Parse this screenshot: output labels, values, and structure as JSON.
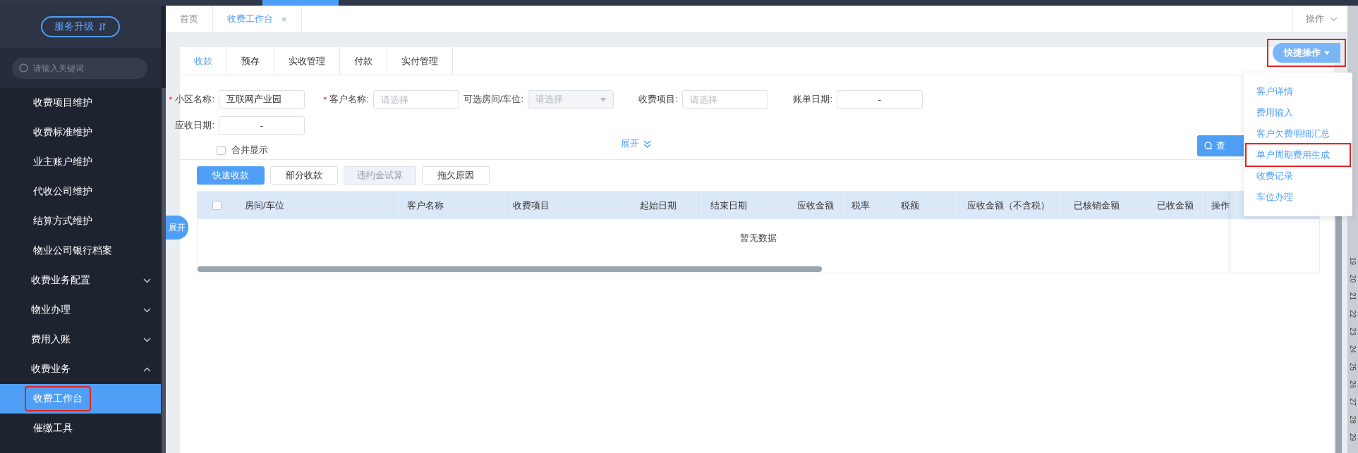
{
  "sidebar": {
    "upgrade_button": "服务升级",
    "search": {
      "placeholder": "请输入关键词"
    },
    "items": [
      {
        "label": "收费项目维护",
        "kind": "sub",
        "selected": false,
        "highlighted": false
      },
      {
        "label": "收费标准维护",
        "kind": "sub",
        "selected": false,
        "highlighted": false
      },
      {
        "label": "业主账户维护",
        "kind": "sub",
        "selected": false,
        "highlighted": false
      },
      {
        "label": "代收公司维护",
        "kind": "sub",
        "selected": false,
        "highlighted": false
      },
      {
        "label": "结算方式维护",
        "kind": "sub",
        "selected": false,
        "highlighted": false
      },
      {
        "label": "物业公司银行档案",
        "kind": "sub",
        "selected": false,
        "highlighted": false
      },
      {
        "label": "收费业务配置",
        "kind": "group",
        "expanded": false,
        "selected": false,
        "highlighted": false
      },
      {
        "label": "物业办理",
        "kind": "group",
        "expanded": false,
        "selected": false,
        "highlighted": false
      },
      {
        "label": "费用入账",
        "kind": "group",
        "expanded": false,
        "selected": false,
        "highlighted": false
      },
      {
        "label": "收费业务",
        "kind": "group",
        "expanded": true,
        "selected": false,
        "highlighted": false
      },
      {
        "label": "收费工作台",
        "kind": "sub",
        "selected": true,
        "highlighted": true
      },
      {
        "label": "催缴工具",
        "kind": "sub",
        "selected": false,
        "highlighted": false
      }
    ]
  },
  "page_tabs": [
    {
      "label": "首页",
      "selected": false
    },
    {
      "label": "收费工作台",
      "selected": true,
      "close": "×"
    }
  ],
  "operations_menu": "操作",
  "quick_actions": {
    "label": "快捷操作",
    "highlighted": true,
    "items": [
      {
        "label": "客户详情",
        "highlighted": false
      },
      {
        "label": "费用输入",
        "highlighted": false
      },
      {
        "label": "客户欠费明细汇总",
        "highlighted": false
      },
      {
        "label": "单户周期费用生成",
        "highlighted": true
      },
      {
        "label": "收费记录",
        "highlighted": false
      },
      {
        "label": "车位办理",
        "highlighted": false
      }
    ]
  },
  "tabs": [
    {
      "label": "收款",
      "selected": true
    },
    {
      "label": "预存",
      "selected": false
    },
    {
      "label": "实收管理",
      "selected": false
    },
    {
      "label": "付款",
      "selected": false
    },
    {
      "label": "实付管理",
      "selected": false
    }
  ],
  "form": {
    "fields": [
      {
        "label": "小区名称:",
        "required_mark": "*",
        "kind": "text",
        "value": "互联网产业园"
      },
      {
        "label": "客户名称:",
        "required_mark": "*",
        "kind": "text",
        "placeholder": "请选择"
      },
      {
        "label": "可选房间/车位:",
        "kind": "select",
        "placeholder": "请选择"
      },
      {
        "label": "收费项目:",
        "kind": "text",
        "placeholder": "请选择"
      },
      {
        "label": "账单日期:",
        "kind": "range",
        "separator": "-"
      },
      {
        "label": "应收日期:",
        "kind": "range",
        "separator": "-"
      }
    ],
    "merge_checkbox": {
      "label": "合并显示",
      "checked": false
    },
    "expand_link": "展开",
    "query_button": "查"
  },
  "actions": [
    {
      "label": "快速收款",
      "kind": "primary"
    },
    {
      "label": "部分收款",
      "kind": "default"
    },
    {
      "label": "违约金试算",
      "kind": "disabled"
    },
    {
      "label": "拖欠原因",
      "kind": "default"
    }
  ],
  "table": {
    "select_all": {
      "checked": false
    },
    "columns": [
      "房间/车位",
      "客户名称",
      "收费项目",
      "起始日期",
      "结束日期",
      "应收金额",
      "税率",
      "税额",
      "应收金额（不含税）",
      "已核销金额",
      "已收金额",
      "操作"
    ],
    "empty_text": "暂无数据"
  },
  "side_toggle": "展开",
  "ruler": [
    "19",
    "20",
    "21",
    "22",
    "23",
    "24",
    "25",
    "26",
    "27",
    "28",
    "29"
  ]
}
